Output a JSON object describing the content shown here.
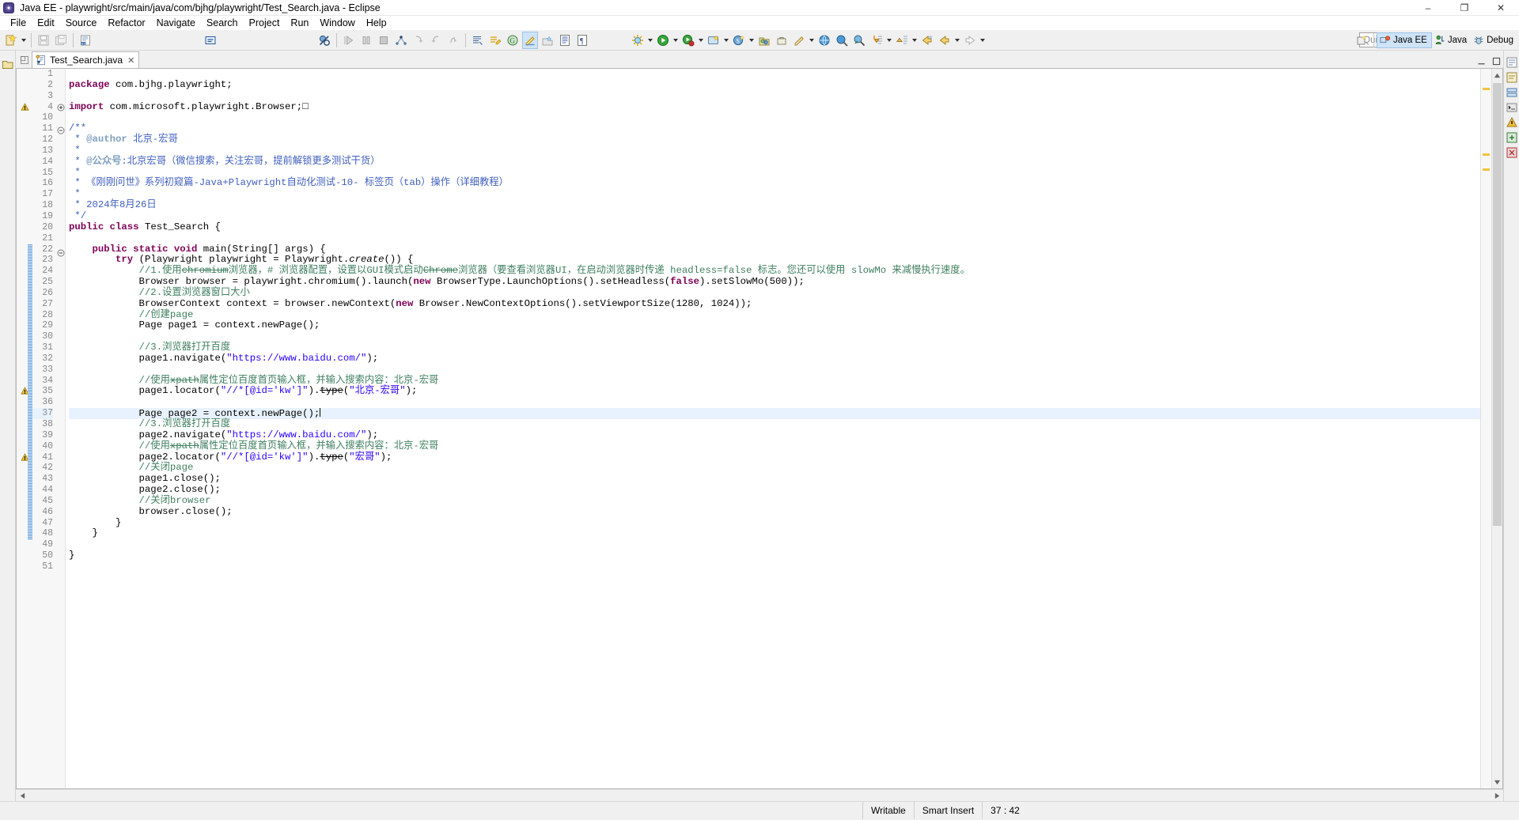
{
  "window": {
    "title": "Java EE - playwright/src/main/java/com/bjhg/playwright/Test_Search.java - Eclipse",
    "icon": "eclipse-icon",
    "minimize": "–",
    "maximize": "❐",
    "close": "✕"
  },
  "menubar": {
    "items": [
      {
        "label": "File",
        "name": "menu-file"
      },
      {
        "label": "Edit",
        "name": "menu-edit"
      },
      {
        "label": "Source",
        "name": "menu-source"
      },
      {
        "label": "Refactor",
        "name": "menu-refactor"
      },
      {
        "label": "Navigate",
        "name": "menu-navigate"
      },
      {
        "label": "Search",
        "name": "menu-search"
      },
      {
        "label": "Project",
        "name": "menu-project"
      },
      {
        "label": "Run",
        "name": "menu-run"
      },
      {
        "label": "Window",
        "name": "menu-window"
      },
      {
        "label": "Help",
        "name": "menu-help"
      }
    ]
  },
  "toolbar": {
    "quick_access_placeholder": "Quick Access",
    "quick_access_value": "",
    "icons": [
      "new-wizard-icon",
      "save-icon",
      "save-all-icon",
      "print-icon",
      "toggle-comment-icon",
      "skip-breakpoints-icon",
      "run-step-icon",
      "suspend-icon",
      "terminate-icon",
      "step-into-icon",
      "step-over-icon",
      "step-return-icon",
      "drop-to-frame-icon"
    ]
  },
  "perspectives": {
    "open_label": "",
    "items": [
      {
        "label": "Java EE",
        "name": "perspective-java-ee",
        "active": true
      },
      {
        "label": "Java",
        "name": "perspective-java",
        "active": false
      },
      {
        "label": "Debug",
        "name": "perspective-debug",
        "active": false
      }
    ]
  },
  "editor": {
    "tab_label": "Test_Search.java",
    "tab_close": "✕",
    "file_icon": "java-file-icon"
  },
  "code": {
    "lines": [
      {
        "n": "1",
        "text": "",
        "segs": []
      },
      {
        "n": "2",
        "segs": [
          {
            "t": "package ",
            "c": "kw"
          },
          {
            "t": "com.bjhg.playwright;",
            "c": "plain"
          }
        ]
      },
      {
        "n": "3",
        "segs": []
      },
      {
        "n": "4",
        "marker": "warning",
        "fold": "plus",
        "segs": [
          {
            "t": "import ",
            "c": "kw"
          },
          {
            "t": "com.microsoft.playwright.Browser;",
            "c": "plain"
          },
          {
            "t": "□",
            "c": "plain"
          }
        ]
      },
      {
        "n": "10",
        "segs": []
      },
      {
        "n": "11",
        "fold": "minus",
        "segs": [
          {
            "t": "/**",
            "c": "jdoc"
          }
        ]
      },
      {
        "n": "12",
        "segs": [
          {
            "t": " * ",
            "c": "jdoc"
          },
          {
            "t": "@author",
            "c": "jtag"
          },
          {
            "t": " 北京-宏哥",
            "c": "jdoc"
          }
        ]
      },
      {
        "n": "13",
        "segs": [
          {
            "t": " * ",
            "c": "jdoc"
          }
        ]
      },
      {
        "n": "14",
        "segs": [
          {
            "t": " * ",
            "c": "jdoc"
          },
          {
            "t": "@公众号",
            "c": "jtag"
          },
          {
            "t": ":北京宏哥（微信搜索，关注宏哥，提前解锁更多测试干货）",
            "c": "jdoc"
          }
        ]
      },
      {
        "n": "15",
        "segs": [
          {
            "t": " * ",
            "c": "jdoc"
          }
        ]
      },
      {
        "n": "16",
        "segs": [
          {
            "t": " * 《刚刚问世》系列初窥篇-Java+Playwright自动化测试-10- 标签页（tab）操作（详细教程）",
            "c": "jdoc"
          }
        ]
      },
      {
        "n": "17",
        "segs": [
          {
            "t": " * ",
            "c": "jdoc"
          }
        ]
      },
      {
        "n": "18",
        "segs": [
          {
            "t": " * 2024年8月26日",
            "c": "jdoc"
          }
        ]
      },
      {
        "n": "19",
        "segs": [
          {
            "t": " */",
            "c": "jdoc"
          }
        ]
      },
      {
        "n": "20",
        "segs": [
          {
            "t": "public class ",
            "c": "kw"
          },
          {
            "t": "Test_Search {",
            "c": "plain"
          }
        ]
      },
      {
        "n": "21",
        "segs": []
      },
      {
        "n": "22",
        "fold": "minus",
        "bar": true,
        "segs": [
          {
            "t": "    ",
            "c": "plain"
          },
          {
            "t": "public static void ",
            "c": "kw"
          },
          {
            "t": "main(",
            "c": "plain"
          },
          {
            "t": "String",
            "c": "plain"
          },
          {
            "t": "[] args) {",
            "c": "plain"
          }
        ]
      },
      {
        "n": "23",
        "bar": true,
        "segs": [
          {
            "t": "        ",
            "c": "plain"
          },
          {
            "t": "try ",
            "c": "kw"
          },
          {
            "t": "(Playwright playwright = Playwright.",
            "c": "plain"
          },
          {
            "t": "create",
            "c": "stat"
          },
          {
            "t": "()) {",
            "c": "plain"
          }
        ]
      },
      {
        "n": "24",
        "bar": true,
        "segs": [
          {
            "t": "            //1.使用",
            "c": "cmt"
          },
          {
            "t": "chromium",
            "c": "cmt dep"
          },
          {
            "t": "浏览器，# 浏览器配置，设置以",
            "c": "cmt"
          },
          {
            "t": "GUI",
            "c": "cmt"
          },
          {
            "t": "模式启动",
            "c": "cmt"
          },
          {
            "t": "Chrome",
            "c": "cmt dep"
          },
          {
            "t": "浏览器（要查看浏览器",
            "c": "cmt"
          },
          {
            "t": "UI",
            "c": "cmt"
          },
          {
            "t": "，在启动浏览器时传递 ",
            "c": "cmt"
          },
          {
            "t": "headless=false",
            "c": "cmt"
          },
          {
            "t": " 标志。您还可以使用 ",
            "c": "cmt"
          },
          {
            "t": "slowMo",
            "c": "cmt"
          },
          {
            "t": " 来减慢执行速度。",
            "c": "cmt"
          }
        ]
      },
      {
        "n": "25",
        "bar": true,
        "segs": [
          {
            "t": "            Browser browser = playwright.",
            "c": "plain"
          },
          {
            "t": "chromium",
            "c": "plain"
          },
          {
            "t": "().launch(",
            "c": "plain"
          },
          {
            "t": "new ",
            "c": "kw"
          },
          {
            "t": "BrowserType.LaunchOptions().setHeadless(",
            "c": "plain"
          },
          {
            "t": "false",
            "c": "kw"
          },
          {
            "t": ").setSlowMo(500));",
            "c": "plain"
          }
        ]
      },
      {
        "n": "26",
        "bar": true,
        "segs": [
          {
            "t": "            //2.设置浏览器窗口大小",
            "c": "cmt"
          }
        ]
      },
      {
        "n": "27",
        "bar": true,
        "segs": [
          {
            "t": "            BrowserContext context = browser.newContext(",
            "c": "plain"
          },
          {
            "t": "new ",
            "c": "kw"
          },
          {
            "t": "Browser.NewContextOptions().setViewportSize(1280, 1024));",
            "c": "plain"
          }
        ]
      },
      {
        "n": "28",
        "bar": true,
        "segs": [
          {
            "t": "            //创建",
            "c": "cmt"
          },
          {
            "t": "page",
            "c": "cmt"
          }
        ]
      },
      {
        "n": "29",
        "bar": true,
        "segs": [
          {
            "t": "            Page page1 = context.newPage();",
            "c": "plain"
          }
        ]
      },
      {
        "n": "30",
        "bar": true,
        "segs": []
      },
      {
        "n": "31",
        "bar": true,
        "segs": [
          {
            "t": "            //3.浏览器打开百度",
            "c": "cmt"
          }
        ]
      },
      {
        "n": "32",
        "bar": true,
        "segs": [
          {
            "t": "            page1.navigate(",
            "c": "plain"
          },
          {
            "t": "\"https://www.baidu.com/\"",
            "c": "str"
          },
          {
            "t": ");",
            "c": "plain"
          }
        ]
      },
      {
        "n": "33",
        "bar": true,
        "segs": []
      },
      {
        "n": "34",
        "bar": true,
        "segs": [
          {
            "t": "            //使用",
            "c": "cmt"
          },
          {
            "t": "xpath",
            "c": "cmt dep"
          },
          {
            "t": "属性定位百度首页输入框，并输入搜索内容：北京-宏哥",
            "c": "cmt"
          }
        ]
      },
      {
        "n": "35",
        "marker": "warning",
        "bar": true,
        "segs": [
          {
            "t": "            page1.locator(",
            "c": "plain"
          },
          {
            "t": "\"//*[@id='kw']\"",
            "c": "str"
          },
          {
            "t": ").",
            "c": "plain"
          },
          {
            "t": "type",
            "c": "plain dep"
          },
          {
            "t": "(",
            "c": "plain"
          },
          {
            "t": "\"北京-宏哥\"",
            "c": "str"
          },
          {
            "t": ");",
            "c": "plain"
          }
        ]
      },
      {
        "n": "36",
        "bar": true,
        "segs": []
      },
      {
        "n": "37",
        "bar": true,
        "caret": true,
        "segs": [
          {
            "t": "            Page page2 = context.newPage();",
            "c": "plain"
          }
        ]
      },
      {
        "n": "38",
        "bar": true,
        "segs": [
          {
            "t": "            //3.浏览器打开百度",
            "c": "cmt"
          }
        ]
      },
      {
        "n": "39",
        "bar": true,
        "segs": [
          {
            "t": "            page2.navigate(",
            "c": "plain"
          },
          {
            "t": "\"https://www.baidu.com/\"",
            "c": "str"
          },
          {
            "t": ");",
            "c": "plain"
          }
        ]
      },
      {
        "n": "40",
        "bar": true,
        "segs": [
          {
            "t": "            //使用",
            "c": "cmt"
          },
          {
            "t": "xpath",
            "c": "cmt dep"
          },
          {
            "t": "属性定位百度首页输入框，并输入搜索内容：北京-宏哥",
            "c": "cmt"
          }
        ]
      },
      {
        "n": "41",
        "marker": "warning",
        "bar": true,
        "segs": [
          {
            "t": "            page2.locator(",
            "c": "plain"
          },
          {
            "t": "\"//*[@id='kw']\"",
            "c": "str"
          },
          {
            "t": ").",
            "c": "plain"
          },
          {
            "t": "type",
            "c": "plain dep"
          },
          {
            "t": "(",
            "c": "plain"
          },
          {
            "t": "\"宏哥\"",
            "c": "str"
          },
          {
            "t": ");",
            "c": "plain"
          }
        ]
      },
      {
        "n": "42",
        "bar": true,
        "segs": [
          {
            "t": "            //关闭",
            "c": "cmt"
          },
          {
            "t": "page",
            "c": "cmt"
          }
        ]
      },
      {
        "n": "43",
        "bar": true,
        "segs": [
          {
            "t": "            page1.close();",
            "c": "plain"
          }
        ]
      },
      {
        "n": "44",
        "bar": true,
        "segs": [
          {
            "t": "            page2.close();",
            "c": "plain"
          }
        ]
      },
      {
        "n": "45",
        "bar": true,
        "segs": [
          {
            "t": "            //关闭",
            "c": "cmt"
          },
          {
            "t": "browser",
            "c": "cmt"
          }
        ]
      },
      {
        "n": "46",
        "bar": true,
        "segs": [
          {
            "t": "            browser.close();",
            "c": "plain"
          }
        ]
      },
      {
        "n": "47",
        "bar": true,
        "segs": [
          {
            "t": "        }",
            "c": "plain"
          }
        ]
      },
      {
        "n": "48",
        "bar": true,
        "segs": [
          {
            "t": "    }",
            "c": "plain"
          }
        ]
      },
      {
        "n": "49",
        "segs": []
      },
      {
        "n": "50",
        "segs": [
          {
            "t": "}",
            "c": "plain"
          }
        ]
      },
      {
        "n": "51",
        "segs": []
      }
    ]
  },
  "statusbar": {
    "writable": "Writable",
    "insert_mode": "Smart Insert",
    "position": "37 : 42"
  },
  "colors": {
    "keyword": "#7f0055",
    "string": "#2a00ff",
    "comment": "#3f7f5f",
    "javadoc": "#3f5fbf",
    "javadoc_tag": "#7f9fbf",
    "caret_line": "#e8f2fe",
    "accent": "#cfe3f7"
  }
}
